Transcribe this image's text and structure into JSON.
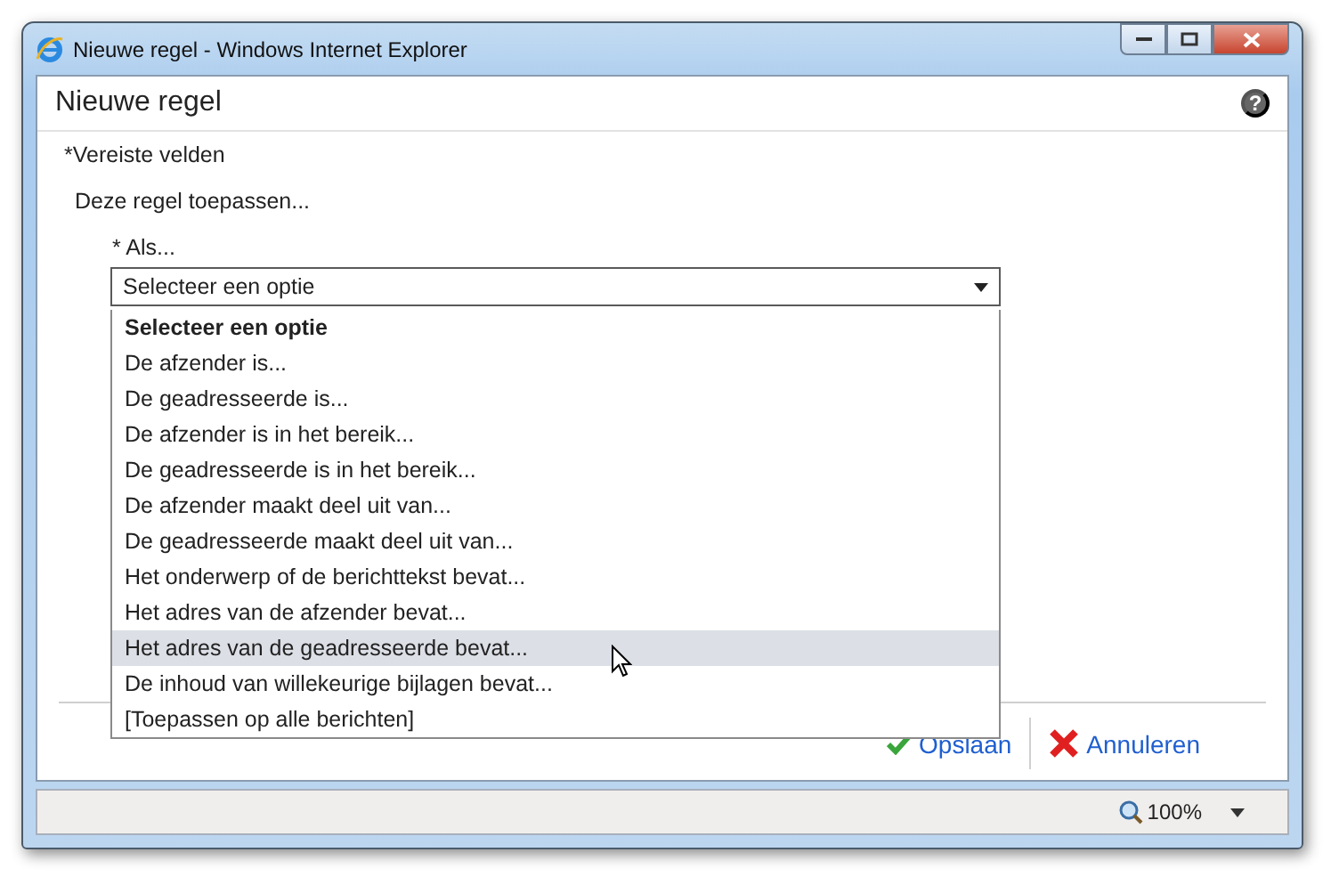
{
  "window": {
    "title": "Nieuwe regel - Windows Internet Explorer"
  },
  "dialog": {
    "title": "Nieuwe regel",
    "help": "?",
    "required_note": "*Vereiste velden",
    "intro": "Deze regel toepassen...",
    "condition": {
      "label": "* Als...",
      "value": "Selecteer een optie",
      "expanded": true,
      "options": [
        {
          "label": "Selecteer een optie",
          "selected": true,
          "highlighted": false
        },
        {
          "label": "De afzender is...",
          "selected": false,
          "highlighted": false
        },
        {
          "label": "De geadresseerde is...",
          "selected": false,
          "highlighted": false
        },
        {
          "label": "De afzender is in het bereik...",
          "selected": false,
          "highlighted": false
        },
        {
          "label": "De geadresseerde is in het bereik...",
          "selected": false,
          "highlighted": false
        },
        {
          "label": "De afzender maakt deel uit van...",
          "selected": false,
          "highlighted": false
        },
        {
          "label": "De geadresseerde maakt deel uit van...",
          "selected": false,
          "highlighted": false
        },
        {
          "label": "Het onderwerp of de berichttekst bevat...",
          "selected": false,
          "highlighted": false
        },
        {
          "label": "Het adres van de afzender bevat...",
          "selected": false,
          "highlighted": false
        },
        {
          "label": "Het adres van de geadresseerde bevat...",
          "selected": false,
          "highlighted": true
        },
        {
          "label": "De inhoud van willekeurige bijlagen bevat...",
          "selected": false,
          "highlighted": false
        },
        {
          "label": "[Toepassen op alle berichten]",
          "selected": false,
          "highlighted": false
        }
      ]
    },
    "buttons": [
      {
        "label": "Opslaan",
        "kind": "save"
      },
      {
        "label": "Annuleren",
        "kind": "cancel"
      }
    ]
  },
  "status_bar": {
    "zoom": "100%"
  }
}
